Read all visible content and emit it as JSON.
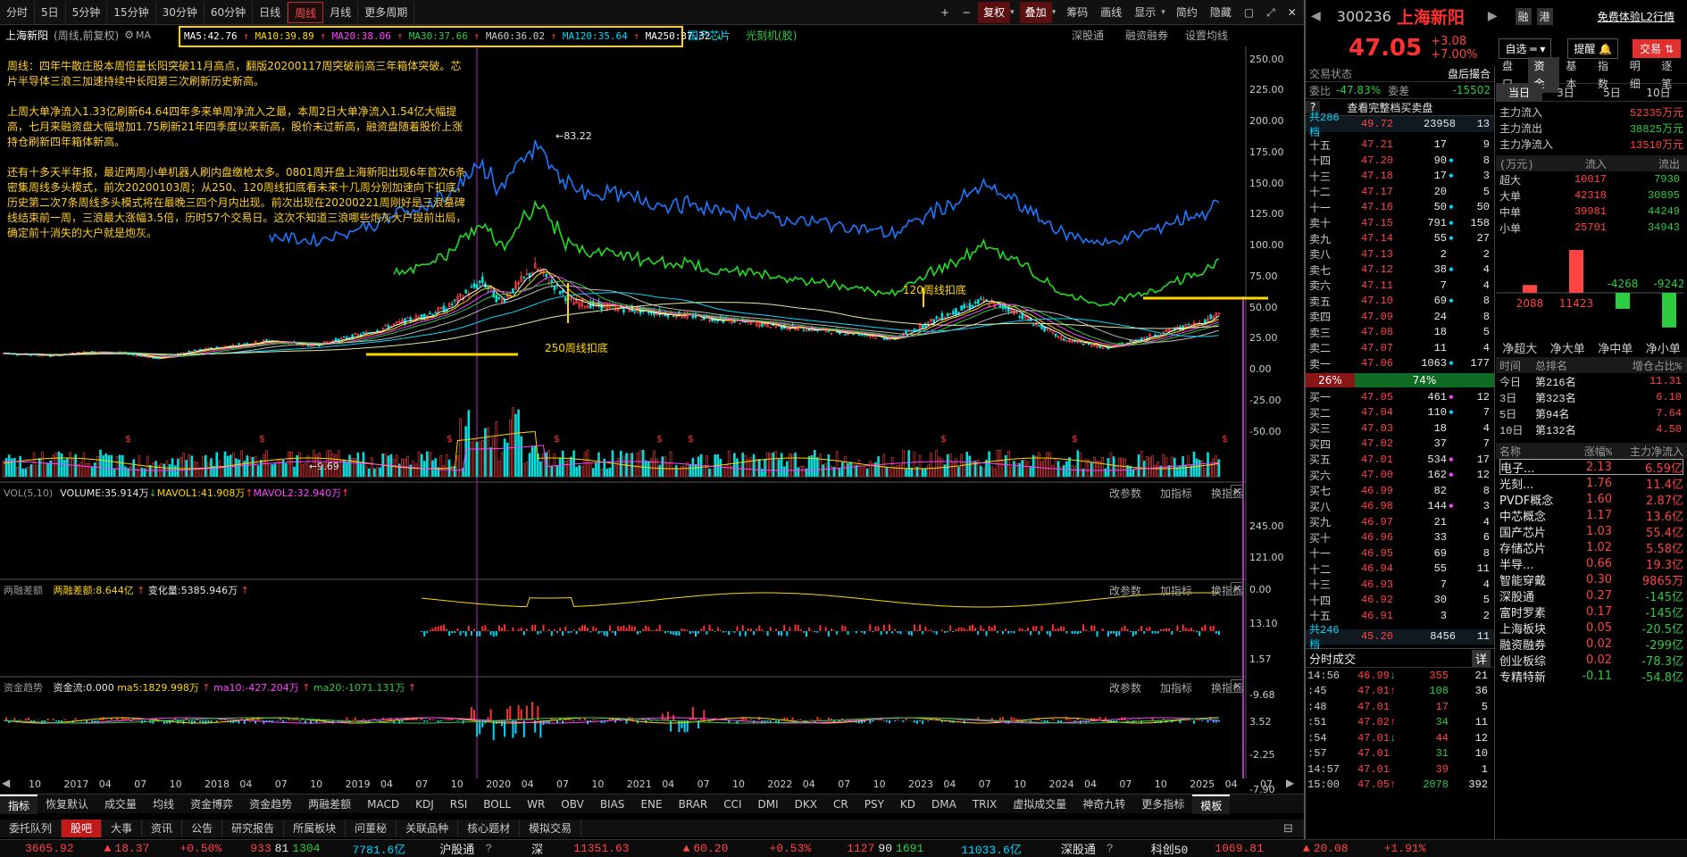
{
  "topbar": {
    "periods": [
      "分时",
      "5日",
      "5分钟",
      "15分钟",
      "30分钟",
      "60分钟",
      "日线",
      "周线",
      "月线",
      "更多周期"
    ],
    "active_period": "周线",
    "tools": [
      "+",
      "−",
      "复权",
      "叠加",
      "筹码",
      "画线",
      "显示",
      "简约",
      "隐藏"
    ],
    "tool_glyphs": [
      "▢",
      "⤢",
      "✕"
    ]
  },
  "info": {
    "stock": "上海新阳",
    "mode": "(周线,前复权)",
    "ma_prefix": "MA",
    "ma": [
      "MA5:42.76",
      "MA10:39.89",
      "MA20:38.06",
      "MA30:37.66",
      "MA60:36.02",
      "MA120:35.64",
      "MA250:37.32"
    ],
    "tags": [
      "国产芯片",
      "光刻机(胶)"
    ],
    "right_links": [
      "深股通",
      "融资融券",
      "设置均线"
    ]
  },
  "annotation": {
    "paras": [
      "周线：四年牛散庄股本周倍量长阳突破11月高点，翻版20200117周突破前高三年箱体突破。芯片半导体三浪三加速持续中长阳第三次刷新历史新高。",
      "上周大单净流入1.33亿刷新64.64四年多来单周净流入之最，本周2日大单净流入1.54亿大幅提高，七月来融资盘大幅增加1.75刷新21年四季度以来新高，股价未过新高，融资盘随着股价上涨持仓刷新四年箱体新高。",
      "还有十多天半年报，最近两周小单机器人刷内盘缴枪太多。0801周开盘上海新阳出现6年首次6条密集周线多头模式，前次20200103周；从250、120周线扣底看未来十几周分别加速向下扣底，历史第二次7条周线多头模式将在最晚三四个月内出现。前次出现在20200221周刚好是三浪墓碑线结束前一周，三浪最大涨幅3.5倍，历时57个交易日。这次不知道三浪哪些炮灰大户提前出局，确定前十消失的大户就是炮灰。"
    ]
  },
  "chart_labels": {
    "high": "83.22",
    "low": "9.69",
    "kd250": "250周线扣底",
    "kd120": "120周线扣底"
  },
  "main_axis": [
    "250.00",
    "225.00",
    "200.00",
    "175.00",
    "150.00",
    "125.00",
    "100.00",
    "75.00",
    "50.00",
    "25.00",
    "0.00",
    "-25.00",
    "-50.00"
  ],
  "vol": {
    "title": "VOL(5,10)",
    "items": [
      "VOLUME:35.914万",
      "MAVOL1:41.908万",
      "MAVOL2:32.940万"
    ],
    "axis": [
      "245.00",
      "121.00",
      "0.00"
    ]
  },
  "margin": {
    "title": "两融差额",
    "items": [
      "两融差额:8.644亿",
      "变化量:5385.946万"
    ],
    "axis": [
      "13.10",
      "1.57",
      "-9.68"
    ]
  },
  "fund": {
    "title": "资金趋势",
    "items": [
      "资金流:0.000",
      "ma5:1829.998万",
      "ma10:-427.204万",
      "ma20:-1071.131万"
    ],
    "axis": [
      "3.52",
      "-2.25",
      "-7.90"
    ]
  },
  "sub_links": [
    "改参数",
    "加指标",
    "换指标"
  ],
  "time_axis": [
    "10",
    "2017",
    "04",
    "07",
    "10",
    "2018",
    "04",
    "07",
    "10",
    "2019",
    "04",
    "07",
    "10",
    "2020",
    "04",
    "07",
    "10",
    "2021",
    "04",
    "07",
    "10",
    "2022",
    "04",
    "07",
    "10",
    "2023",
    "04",
    "07",
    "10",
    "2024",
    "04",
    "07",
    "10",
    "2025",
    "04",
    "07"
  ],
  "bottom_tabs": [
    "指标",
    "恢复默认",
    "成交量",
    "均线",
    "资金博弈",
    "资金趋势",
    "两融差额",
    "MACD",
    "KDJ",
    "RSI",
    "BOLL",
    "WR",
    "OBV",
    "BIAS",
    "ENE",
    "BRAR",
    "CCI",
    "DMI",
    "DKX",
    "CR",
    "PSY",
    "KD",
    "DMA",
    "TRIX",
    "虚拟成交量",
    "神奇九转",
    "更多指标",
    "模板"
  ],
  "bottom_tabs2": [
    "委托队列",
    "股吧",
    "大事",
    "资讯",
    "公告",
    "研究报告",
    "所属板块",
    "问董秘",
    "关联品种",
    "核心题材",
    "模拟交易"
  ],
  "ticker": {
    "sh_val": "3665.92",
    "sh_chg": "18.37",
    "sh_pct": "+0.50%",
    "sh_up": "933",
    "sh_flat": "81",
    "sh_down": "1304",
    "sh_amt": "7781.6亿",
    "hgt": "沪股通",
    "sz_label": "深",
    "sz_val": "11351.63",
    "sz_chg": "60.20",
    "sz_pct": "+0.53%",
    "sz_up": "1127",
    "sz_flat": "90",
    "sz_down": "1691",
    "sz_amt": "11033.6亿",
    "sgt": "深股通",
    "kc": "科创50",
    "kc_val": "1069.81",
    "kc_chg": "20.08",
    "kc_pct": "+1.91%"
  },
  "rp": {
    "code": "300236",
    "name": "上海新阳",
    "badges": [
      "融",
      "港"
    ],
    "trial": "免费体验L2行情",
    "price": "47.05",
    "chg": "+3.08",
    "pct": "+7.00%",
    "btns": [
      "自选",
      "提醒",
      "交易"
    ],
    "status_label": "交易状态",
    "status_val": "盘后撮合",
    "wb_label": "委比",
    "wb_val": "-47.83%",
    "wc_label": "委差",
    "wc_val": "-15502",
    "full_btn": "查看完整档买卖盘",
    "sell_total": {
      "label": "共286档",
      "price": "49.72",
      "vol": "23958",
      "n": "13"
    },
    "asks": [
      [
        "十五",
        "47.21",
        "17",
        "9",
        ""
      ],
      [
        "十四",
        "47.20",
        "90",
        "8",
        "c"
      ],
      [
        "十三",
        "47.18",
        "17",
        "3",
        "c"
      ],
      [
        "十二",
        "47.17",
        "20",
        "5",
        ""
      ],
      [
        "十一",
        "47.16",
        "50",
        "50",
        "c"
      ],
      [
        "卖十",
        "47.15",
        "791",
        "158",
        "c"
      ],
      [
        "卖九",
        "47.14",
        "55",
        "27",
        "c"
      ],
      [
        "卖八",
        "47.13",
        "2",
        "2",
        ""
      ],
      [
        "卖七",
        "47.12",
        "38",
        "4",
        "c"
      ],
      [
        "卖六",
        "47.11",
        "7",
        "4",
        ""
      ],
      [
        "卖五",
        "47.10",
        "69",
        "8",
        "c"
      ],
      [
        "卖四",
        "47.09",
        "24",
        "8",
        ""
      ],
      [
        "卖三",
        "47.08",
        "18",
        "5",
        ""
      ],
      [
        "卖二",
        "47.07",
        "11",
        "4",
        ""
      ],
      [
        "卖一",
        "47.06",
        "1063",
        "177",
        "c"
      ]
    ],
    "ratio_left": "26%",
    "ratio_right": "74%",
    "bids": [
      [
        "买一",
        "47.05",
        "461",
        "12",
        "m"
      ],
      [
        "买二",
        "47.04",
        "110",
        "7",
        "c"
      ],
      [
        "买三",
        "47.03",
        "18",
        "4",
        ""
      ],
      [
        "买四",
        "47.02",
        "37",
        "7",
        ""
      ],
      [
        "买五",
        "47.01",
        "534",
        "17",
        "m"
      ],
      [
        "买六",
        "47.00",
        "162",
        "12",
        "m"
      ],
      [
        "买七",
        "46.99",
        "82",
        "8",
        ""
      ],
      [
        "买八",
        "46.98",
        "144",
        "3",
        "m"
      ],
      [
        "买九",
        "46.97",
        "21",
        "4",
        ""
      ],
      [
        "买十",
        "46.96",
        "33",
        "6",
        ""
      ],
      [
        "十一",
        "46.95",
        "69",
        "8",
        ""
      ],
      [
        "十二",
        "46.94",
        "55",
        "11",
        ""
      ],
      [
        "十三",
        "46.93",
        "7",
        "4",
        ""
      ],
      [
        "十四",
        "46.92",
        "30",
        "5",
        ""
      ],
      [
        "十五",
        "46.91",
        "3",
        "2",
        ""
      ]
    ],
    "buy_total": {
      "label": "共246档",
      "price": "45.20",
      "vol": "8456",
      "n": "11"
    },
    "trades_title": "分时成交",
    "trades_btn": "详",
    "trades": [
      [
        "14:56",
        "46.99",
        "↓",
        "355",
        "21"
      ],
      [
        ":45",
        "47.01",
        "↑",
        "108",
        "36"
      ],
      [
        ":48",
        "47.01",
        "",
        "17",
        "5"
      ],
      [
        ":51",
        "47.02",
        "↑",
        "34",
        "11"
      ],
      [
        ":54",
        "47.01",
        "↓",
        "44",
        "12"
      ],
      [
        ":57",
        "47.01",
        "",
        "31",
        "10"
      ],
      [
        "14:57",
        "47.01",
        "",
        "39",
        "1"
      ],
      [
        "15:00",
        "47.05",
        "↑",
        "2078",
        "392"
      ]
    ],
    "tabs": [
      "盘口",
      "资金",
      "基本",
      "指数",
      "明细",
      "逐笔"
    ],
    "day_tabs": [
      "当日",
      "3日",
      "5日",
      "10日"
    ],
    "flow": [
      [
        "主力流入",
        "52335万元"
      ],
      [
        "主力流出",
        "38825万元"
      ],
      [
        "主力净流入",
        "13510万元"
      ]
    ],
    "flow_head": [
      "(万元)",
      "流入",
      "流出"
    ],
    "flow_table": [
      [
        "超大",
        "10017",
        "7930"
      ],
      [
        "大单",
        "42318",
        "30895"
      ],
      [
        "中单",
        "39981",
        "44249"
      ],
      [
        "小单",
        "25701",
        "34943"
      ]
    ],
    "net": [
      {
        "label": "2088",
        "value": 2088
      },
      {
        "label": "11423",
        "value": 11423
      },
      {
        "label": "-4268",
        "value": -4268
      },
      {
        "label": "-9242",
        "value": -9242
      }
    ],
    "net_labels": [
      "净超大",
      "净大单",
      "净中单",
      "净小单"
    ],
    "rank_head": [
      "时间",
      "总排名",
      "增仓占比%"
    ],
    "ranks": [
      [
        "今日",
        "第216名",
        "11.31"
      ],
      [
        "3日",
        "第323名",
        "6.10"
      ],
      [
        "5日",
        "第94名",
        "7.64"
      ],
      [
        "10日",
        "第132名",
        "4.50"
      ]
    ],
    "sector_head": [
      "名称",
      "涨幅%",
      "主力净流入"
    ],
    "sectors": [
      [
        "电子...",
        "2.13",
        "6.59亿"
      ],
      [
        "光刻...",
        "1.76",
        "11.4亿"
      ],
      [
        "PVDF概念",
        "1.60",
        "2.87亿"
      ],
      [
        "中芯概念",
        "1.17",
        "13.6亿"
      ],
      [
        "国产芯片",
        "1.03",
        "55.4亿"
      ],
      [
        "存储芯片",
        "1.02",
        "5.58亿"
      ],
      [
        "半导...",
        "0.66",
        "19.3亿"
      ],
      [
        "智能穿戴",
        "0.30",
        "9865万"
      ],
      [
        "深股通",
        "0.27",
        "-145亿"
      ],
      [
        "富时罗素",
        "0.17",
        "-145亿"
      ],
      [
        "上海板块",
        "0.05",
        "-20.5亿"
      ],
      [
        "融资融券",
        "0.02",
        "-299亿"
      ],
      [
        "创业板综",
        "0.02",
        "-78.3亿"
      ],
      [
        "专精特新",
        "-0.11",
        "-54.8亿"
      ]
    ]
  },
  "colors": {
    "up": "#ff4444",
    "down": "#2ecc40",
    "accent": "#ffd700",
    "blue": "#1e90ff",
    "green": "#22cc22"
  }
}
